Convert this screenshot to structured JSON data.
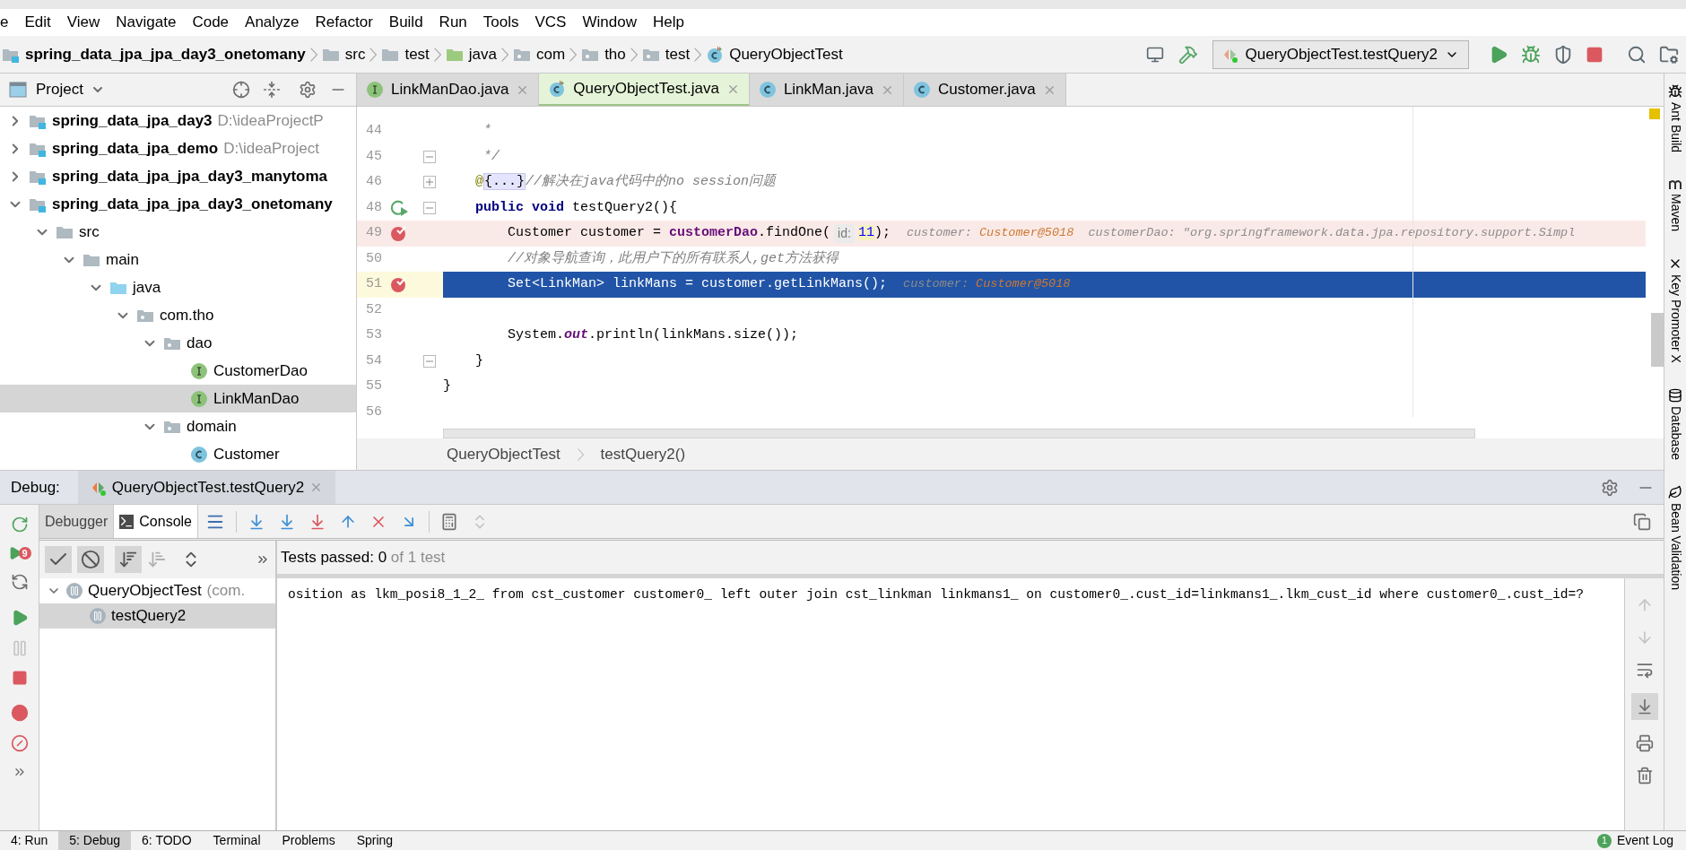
{
  "menu": [
    "e",
    "Edit",
    "View",
    "Navigate",
    "Code",
    "Analyze",
    "Refactor",
    "Build",
    "Run",
    "Tools",
    "VCS",
    "Window",
    "Help"
  ],
  "breadcrumbs": [
    {
      "label": "spring_data_jpa_jpa_day3_onetomany",
      "kind": "module"
    },
    {
      "label": "src",
      "kind": "folder"
    },
    {
      "label": "test",
      "kind": "folder"
    },
    {
      "label": "java",
      "kind": "test-folder"
    },
    {
      "label": "com",
      "kind": "package"
    },
    {
      "label": "tho",
      "kind": "package"
    },
    {
      "label": "test",
      "kind": "package"
    },
    {
      "label": "QueryObjectTest",
      "kind": "test-class"
    }
  ],
  "run_config": {
    "label": "QueryObjectTest.testQuery2"
  },
  "project_panel": {
    "title": "Project",
    "tree": [
      {
        "label": "spring_data_jpa_day3",
        "path": "D:\\ideaProjectP",
        "kind": "module",
        "bold": true,
        "expanded": false,
        "selected": false
      },
      {
        "label": "spring_data_jpa_demo",
        "path": "D:\\ideaProject",
        "kind": "module",
        "bold": true,
        "expanded": false,
        "selected": false
      },
      {
        "label": "spring_data_jpa_jpa_day3_manytoma",
        "kind": "module",
        "bold": true,
        "expanded": false,
        "selected": false
      },
      {
        "label": "spring_data_jpa_jpa_day3_onetomany",
        "kind": "module",
        "bold": true,
        "expanded": true,
        "selected": false,
        "children": [
          {
            "label": "src",
            "kind": "folder",
            "bold": false,
            "expanded": true,
            "selected": false,
            "children": [
              {
                "label": "main",
                "kind": "folder",
                "bold": false,
                "expanded": true,
                "selected": false,
                "children": [
                  {
                    "label": "java",
                    "kind": "source-folder",
                    "bold": false,
                    "expanded": true,
                    "selected": false,
                    "children": [
                      {
                        "label": "com.tho",
                        "kind": "package",
                        "bold": false,
                        "expanded": true,
                        "selected": false,
                        "children": [
                          {
                            "label": "dao",
                            "kind": "package",
                            "bold": false,
                            "expanded": true,
                            "selected": false,
                            "children": [
                              {
                                "label": "CustomerDao",
                                "kind": "interface",
                                "bold": false,
                                "selected": false
                              },
                              {
                                "label": "LinkManDao",
                                "kind": "interface",
                                "bold": false,
                                "selected": true
                              }
                            ]
                          },
                          {
                            "label": "domain",
                            "kind": "package",
                            "bold": false,
                            "expanded": true,
                            "selected": false,
                            "children": [
                              {
                                "label": "Customer",
                                "kind": "class",
                                "bold": false,
                                "selected": false
                              }
                            ]
                          }
                        ]
                      }
                    ]
                  }
                ]
              }
            ]
          }
        ]
      }
    ]
  },
  "editor_tabs": [
    {
      "label": "LinkManDao.java",
      "kind": "interface",
      "selected": false
    },
    {
      "label": "QueryObjectTest.java",
      "kind": "test-class",
      "selected": true
    },
    {
      "label": "LinkMan.java",
      "kind": "class",
      "selected": false
    },
    {
      "label": "Customer.java",
      "kind": "class",
      "selected": false
    }
  ],
  "editor": {
    "lines": [
      {
        "number": "44",
        "breakpoint": false,
        "current": false,
        "runnable": false,
        "segments": [
          {
            "kind": "code",
            "tokens": [
              {
                "text": "     *",
                "kind": "comment"
              }
            ]
          }
        ]
      },
      {
        "number": "45",
        "breakpoint": false,
        "current": false,
        "runnable": false,
        "expanded": true,
        "segments": [
          {
            "kind": "code",
            "tokens": [
              {
                "text": "     */",
                "kind": "comment"
              }
            ]
          }
        ]
      },
      {
        "number": "46",
        "breakpoint": false,
        "current": false,
        "runnable": false,
        "expanded": false,
        "segments": [
          {
            "kind": "code",
            "tokens": [
              {
                "text": "    @",
                "kind": "annotation"
              },
              {
                "text": "{...}",
                "kind": "folded"
              },
              {
                "text": "//解决在java代码中的no session问题",
                "kind": "comment"
              }
            ]
          }
        ]
      },
      {
        "number": "48",
        "breakpoint": false,
        "current": false,
        "runnable": true,
        "expanded": true,
        "segments": [
          {
            "kind": "code",
            "tokens": [
              {
                "text": "    public void ",
                "kind": "keyword"
              },
              {
                "text": "testQuery2(){",
                "kind": "plain"
              }
            ]
          }
        ]
      },
      {
        "number": "49",
        "breakpoint": true,
        "current": false,
        "runnable": false,
        "segments": [
          {
            "kind": "code",
            "tokens": [
              {
                "text": "        Customer customer = ",
                "kind": "plain"
              },
              {
                "text": "customerDao",
                "kind": "field"
              },
              {
                "text": ".findOne(",
                "kind": "plain"
              }
            ]
          },
          {
            "kind": "hint",
            "tokens": [
              {
                "text": "id:",
                "kind": "plain"
              }
            ]
          },
          {
            "kind": "code",
            "tokens": [
              {
                "text": "11",
                "kind": "number"
              },
              {
                "text": ");",
                "kind": "plain"
              }
            ]
          },
          {
            "kind": "debug",
            "tokens": [
              {
                "text": "customer: ",
                "kind": "debug-name"
              },
              {
                "text": "Customer@5018",
                "kind": "debug-value"
              },
              {
                "text": "  customerDao: \"org.springframework.data.jpa.repository.support.Simpl",
                "kind": "debug-name"
              }
            ]
          }
        ]
      },
      {
        "number": "50",
        "breakpoint": false,
        "current": false,
        "runnable": false,
        "segments": [
          {
            "kind": "code",
            "tokens": [
              {
                "text": "        //对象导航查询，此用户下的所有联系人,get方法获得",
                "kind": "comment"
              }
            ]
          }
        ]
      },
      {
        "number": "51",
        "breakpoint": true,
        "current": true,
        "runnable": false,
        "segments": [
          {
            "kind": "code",
            "tokens": [
              {
                "text": "        Set<LinkMan> linkMans = customer.getLinkMans();",
                "kind": "plain"
              }
            ]
          },
          {
            "kind": "debug",
            "tokens": [
              {
                "text": "customer: ",
                "kind": "debug-name"
              },
              {
                "text": "Customer@5018",
                "kind": "debug-value"
              }
            ]
          }
        ]
      },
      {
        "number": "52",
        "breakpoint": false,
        "current": false,
        "runnable": false
      },
      {
        "number": "53",
        "breakpoint": false,
        "current": false,
        "runnable": false,
        "segments": [
          {
            "kind": "code",
            "tokens": [
              {
                "text": "        System.",
                "kind": "plain"
              },
              {
                "text": "out",
                "kind": "static"
              },
              {
                "text": ".println(linkMans.size());",
                "kind": "plain"
              }
            ]
          }
        ]
      },
      {
        "number": "54",
        "breakpoint": false,
        "current": false,
        "runnable": false,
        "expanded": true,
        "segments": [
          {
            "kind": "code",
            "tokens": [
              {
                "text": "    }",
                "kind": "plain"
              }
            ]
          }
        ]
      },
      {
        "number": "55",
        "breakpoint": false,
        "current": false,
        "runnable": false,
        "segments": [
          {
            "kind": "code",
            "tokens": [
              {
                "text": "}",
                "kind": "plain"
              }
            ]
          }
        ]
      },
      {
        "number": "56",
        "breakpoint": false,
        "current": false,
        "runnable": false
      }
    ]
  },
  "editor_breadcrumb": [
    "QueryObjectTest",
    "testQuery2()"
  ],
  "debug": {
    "label": "Debug:",
    "session_tab": "QueryObjectTest.testQuery2",
    "rerun_badge": "9",
    "subtabs": [
      {
        "label": "Debugger",
        "selected": false
      },
      {
        "label": "Console",
        "selected": true
      }
    ],
    "tests_status": {
      "label": "Tests passed:",
      "count": "0",
      "total": "of 1 test"
    },
    "test_tree": [
      {
        "label": "QueryObjectTest",
        "detail": "(com.",
        "expanded": true,
        "selected": false,
        "children": [
          {
            "label": "testQuery2",
            "selected": true
          }
        ]
      }
    ],
    "console_lines": [
      "osition as lkm_posi8_1_2_ from cst_customer customer0_ left outer join cst_linkman linkmans1_ on customer0_.cust_id=linkmans1_.lkm_cust_id where customer0_.cust_id=?"
    ]
  },
  "tool_windows_right": [
    "Ant Build",
    "Maven",
    "Key Promoter X",
    "Database",
    "Bean Validation"
  ],
  "status_bar": {
    "tools": [
      {
        "label": "4: Run",
        "selected": false
      },
      {
        "label": "5: Debug",
        "selected": true
      },
      {
        "label": "6: TODO",
        "selected": false
      },
      {
        "label": "Terminal",
        "selected": false
      },
      {
        "label": "Problems",
        "selected": false
      },
      {
        "label": "Spring",
        "selected": false
      }
    ],
    "event_log": {
      "label": "Event Log",
      "count": "1"
    }
  }
}
